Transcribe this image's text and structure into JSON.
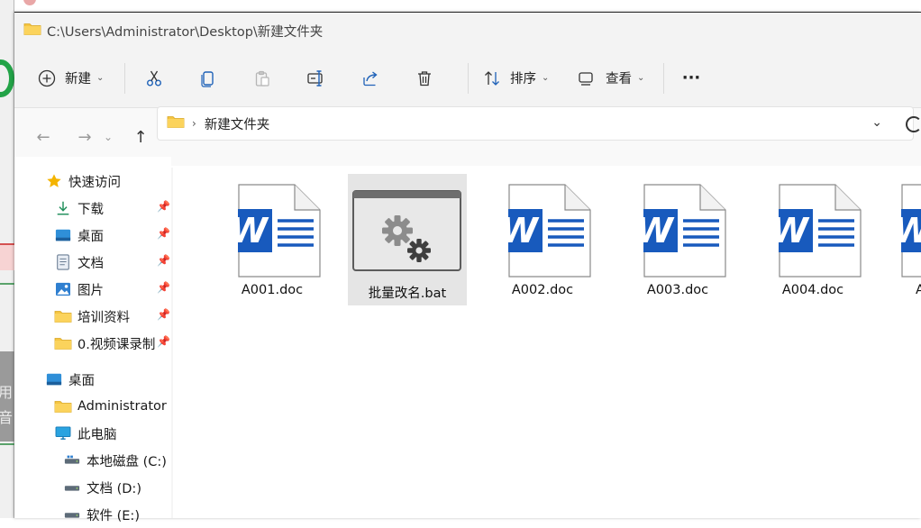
{
  "window": {
    "path": "C:\\Users\\Administrator\\Desktop\\新建文件夹"
  },
  "toolbar": {
    "new_label": "新建",
    "sort_label": "排序",
    "view_label": "查看",
    "more_label": "···",
    "icons": [
      "plus-circle-icon",
      "cut-icon",
      "copy-icon",
      "paste-icon",
      "rename-icon",
      "share-icon",
      "delete-icon",
      "sort-icon",
      "view-icon"
    ]
  },
  "address": {
    "current_folder": "新建文件夹"
  },
  "navpane": {
    "quick_access": "快速访问",
    "items": [
      {
        "label": "下载",
        "icon": "download-icon",
        "pinned": true
      },
      {
        "label": "桌面",
        "icon": "desktop-icon",
        "pinned": true
      },
      {
        "label": "文档",
        "icon": "document-icon",
        "pinned": true
      },
      {
        "label": "图片",
        "icon": "picture-icon",
        "pinned": true
      },
      {
        "label": "培训资料",
        "icon": "folder-icon",
        "pinned": true
      },
      {
        "label": "0.视频课录制",
        "icon": "folder-icon",
        "pinned": true
      }
    ],
    "desktop": "桌面",
    "tree": [
      {
        "label": "Administrator",
        "icon": "folder-icon"
      },
      {
        "label": "此电脑",
        "icon": "pc-icon"
      },
      {
        "label": "本地磁盘 (C:)",
        "icon": "drive-icon"
      },
      {
        "label": "文档 (D:)",
        "icon": "drive-icon"
      },
      {
        "label": "软件 (E:)",
        "icon": "drive-icon"
      }
    ]
  },
  "files": [
    {
      "name": "A001.doc",
      "type": "word"
    },
    {
      "name": "批量改名.bat",
      "type": "bat",
      "selected": true
    },
    {
      "name": "A002.doc",
      "type": "word"
    },
    {
      "name": "A003.doc",
      "type": "word"
    },
    {
      "name": "A004.doc",
      "type": "word"
    },
    {
      "name": "A",
      "type": "word"
    }
  ],
  "colors": {
    "word_blue": "#185abd",
    "folder_yellow": "#f5c542",
    "selection": "#e5e5e5"
  },
  "background": {
    "side_text_1": "用",
    "side_text_2": "音"
  }
}
